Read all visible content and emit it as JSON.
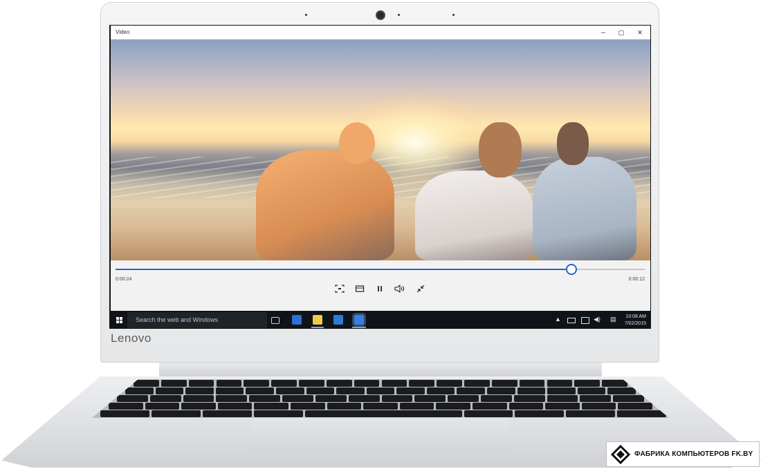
{
  "window": {
    "title": "Video",
    "minimize_label": "─",
    "maximize_label": "▢",
    "close_label": "✕"
  },
  "player": {
    "elapsed": "0:00:24",
    "remaining": "0:00:12",
    "progress_fraction": 0.862,
    "controls": {
      "cast_icon": "cast-icon",
      "mini_view_icon": "mini-view-icon",
      "pause_icon": "pause-icon",
      "volume_icon": "volume-icon",
      "exit_fullscreen_icon": "exit-fullscreen-icon"
    },
    "accent_color": "#2b63c4"
  },
  "taskbar": {
    "search_placeholder": "Search the web and Windows",
    "clock_time": "10:08 AM",
    "clock_date": "7/02/2015",
    "pinned_apps": [
      "task-view-icon",
      "settings-app-icon",
      "file-explorer-icon",
      "store-app-icon",
      "video-app-icon"
    ],
    "tray_icons": [
      "tray-up-arrow-icon",
      "battery-icon",
      "network-icon",
      "volume-tray-icon",
      "action-center-icon"
    ]
  },
  "device": {
    "brand": "Lenovo"
  },
  "watermark": {
    "text": "ФАБРИКА КОМПЬЮТЕРОВ FK.BY"
  }
}
